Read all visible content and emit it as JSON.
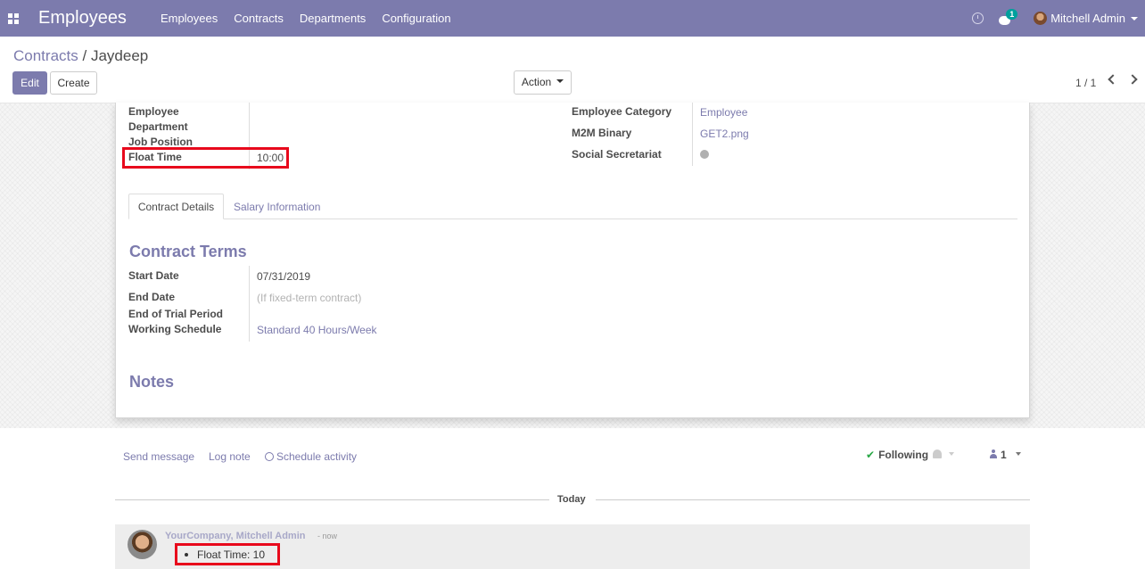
{
  "navbar": {
    "app_title": "Employees",
    "menu": [
      "Employees",
      "Contracts",
      "Departments",
      "Configuration"
    ],
    "chat_badge": "1",
    "user_name": "Mitchell Admin"
  },
  "breadcrumb": {
    "parent": "Contracts",
    "separator": "/",
    "current": "Jaydeep"
  },
  "buttons": {
    "edit": "Edit",
    "create": "Create",
    "action": "Action"
  },
  "pager": {
    "value": "1 / 1"
  },
  "form": {
    "left_fields": [
      {
        "label": "Employee",
        "value": ""
      },
      {
        "label": "Department",
        "value": ""
      },
      {
        "label": "Job Position",
        "value": ""
      },
      {
        "label": "Float Time",
        "value": "10:00"
      }
    ],
    "right_fields": [
      {
        "label": "Employee Category",
        "value": "Employee"
      },
      {
        "label": "M2M Binary",
        "value": "GET2.png"
      },
      {
        "label": "Social Secretariat",
        "value": ""
      }
    ],
    "tabs": [
      "Contract Details",
      "Salary Information"
    ],
    "section_contract_terms": "Contract Terms",
    "terms": [
      {
        "label": "Start Date",
        "value": "07/31/2019"
      },
      {
        "label": "End Date",
        "placeholder": "(If fixed-term contract)"
      },
      {
        "label": "End of Trial Period",
        "value": ""
      },
      {
        "label": "Working Schedule",
        "value": "Standard 40 Hours/Week"
      }
    ],
    "section_notes": "Notes"
  },
  "chatter": {
    "send_message": "Send message",
    "log_note": "Log note",
    "schedule_activity": "Schedule activity",
    "following": "Following",
    "followers_count": "1",
    "today": "Today",
    "message": {
      "author": "YourCompany, Mitchell Admin",
      "time": "- now",
      "tracking": "Float Time: 10"
    }
  },
  "colors": {
    "brand": "#7c7bad",
    "highlight": "#e8091c",
    "following_check": "#28a745"
  }
}
